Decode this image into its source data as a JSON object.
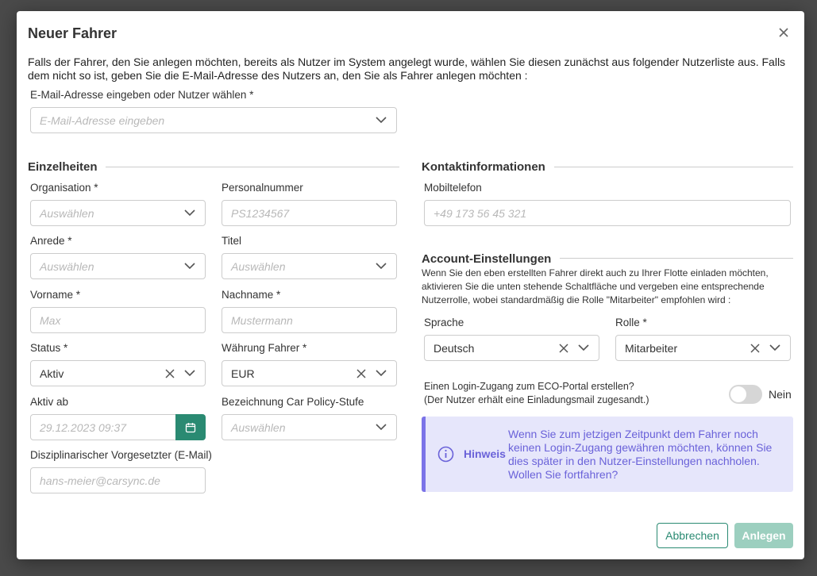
{
  "dialog": {
    "title": "Neuer Fahrer",
    "intro": "Falls der Fahrer, den Sie anlegen möchten, bereits als Nutzer im System angelegt wurde, wählen Sie diesen zunächst aus folgender Nutzerliste aus. Falls dem nicht so ist, geben Sie die E-Mail-Adresse des Nutzers an, den Sie als Fahrer anlegen möchten :"
  },
  "email_select": {
    "label": "E-Mail-Adresse eingeben oder Nutzer wählen *",
    "placeholder": "E-Mail-Adresse eingeben"
  },
  "details": {
    "title": "Einzelheiten",
    "organisation": {
      "label": "Organisation *",
      "placeholder": "Auswählen"
    },
    "personalnummer": {
      "label": "Personalnummer",
      "placeholder": "PS1234567"
    },
    "anrede": {
      "label": "Anrede *",
      "placeholder": "Auswählen"
    },
    "titel": {
      "label": "Titel",
      "placeholder": "Auswählen"
    },
    "vorname": {
      "label": "Vorname *",
      "placeholder": "Max"
    },
    "nachname": {
      "label": "Nachname *",
      "placeholder": "Mustermann"
    },
    "status": {
      "label": "Status *",
      "value": "Aktiv"
    },
    "waehrung": {
      "label": "Währung Fahrer *",
      "value": "EUR"
    },
    "aktiv_ab": {
      "label": "Aktiv ab",
      "placeholder": "29.12.2023 09:37"
    },
    "car_policy": {
      "label": "Bezeichnung Car Policy-Stufe",
      "placeholder": "Auswählen"
    },
    "vorgesetzter": {
      "label": "Disziplinarischer Vorgesetzter (E-Mail)",
      "placeholder": "hans-meier@carsync.de"
    }
  },
  "contact": {
    "title": "Kontaktinformationen",
    "mobil": {
      "label": "Mobiltelefon",
      "placeholder": "+49 173 56 45 321"
    }
  },
  "account": {
    "title": "Account-Einstellungen",
    "description": "Wenn Sie den eben erstellten Fahrer direkt auch zu Ihrer Flotte einladen möchten, aktivieren Sie die unten stehende Schaltfläche und vergeben eine entsprechende Nutzerrolle, wobei standardmäßig die Rolle \"Mitarbeiter\" empfohlen wird :",
    "sprache": {
      "label": "Sprache",
      "value": "Deutsch"
    },
    "rolle": {
      "label": "Rolle *",
      "value": "Mitarbeiter"
    },
    "login_line1": "Einen Login-Zugang zum ECO-Portal erstellen?",
    "login_line2": "(Der Nutzer erhält eine Einladungsmail zugesandt.)",
    "toggle_label": "Nein",
    "toggle_on": false
  },
  "hint": {
    "label": "Hinweis",
    "text": "Wenn Sie zum jetzigen Zeitpunkt dem Fahrer noch keinen Login-Zugang gewähren möchten, können Sie dies später in den Nutzer-Einstellungen nachholen. Wollen Sie fortfahren?"
  },
  "buttons": {
    "cancel": "Abbrechen",
    "create": "Anlegen"
  },
  "colors": {
    "primary": "#2a8a72",
    "hint": "#6a62d9",
    "hint_bg": "#e6e6fb"
  }
}
